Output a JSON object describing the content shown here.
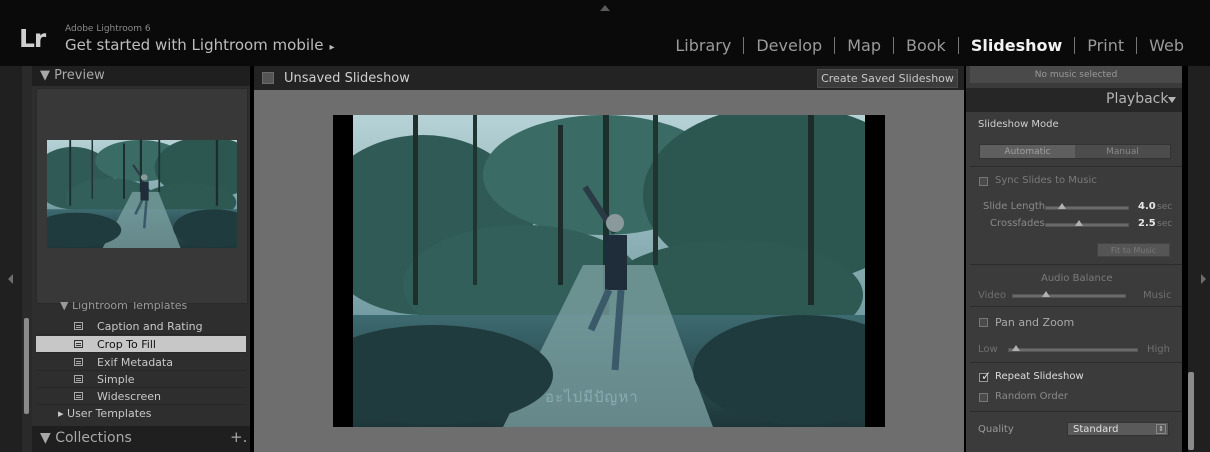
{
  "app": {
    "logo": "Lr",
    "product": "Adobe Lightroom 6",
    "mobile_prompt": "Get started with Lightroom mobile",
    "mobile_arrow": "▸"
  },
  "modules": [
    "Library",
    "Develop",
    "Map",
    "Book",
    "Slideshow",
    "Print",
    "Web"
  ],
  "active_module": "Slideshow",
  "left_panel": {
    "preview_title": "▼ Preview",
    "templates_group": "▼ Lightroom Templates",
    "templates": [
      {
        "label": "Caption and Rating"
      },
      {
        "label": "Crop To Fill"
      },
      {
        "label": "Exif Metadata"
      },
      {
        "label": "Simple"
      },
      {
        "label": "Widescreen"
      }
    ],
    "selected_template": "Crop To Fill",
    "user_templates": "▸  User Templates",
    "collections_title": "▼ Collections",
    "collections_add": "+."
  },
  "center": {
    "slideshow_title": "Unsaved Slideshow",
    "create_button": "Create Saved Slideshow",
    "slide_watermark": "อะไปมีปัญหา"
  },
  "right_panel": {
    "music": "No music selected",
    "playback_title": "Playback",
    "slideshow_mode_label": "Slideshow Mode",
    "mode_options": [
      "Automatic",
      "Manual"
    ],
    "selected_mode": "Automatic",
    "sync_label": "Sync Slides to Music",
    "sync_checked": false,
    "slide_length_label": "Slide Length",
    "slide_length_value": "4.0",
    "crossfades_label": "Crossfades",
    "crossfades_value": "2.5",
    "unit": "sec",
    "fit_button": "Fit to Music",
    "audio_balance_label": "Audio Balance",
    "audio_left": "Video",
    "audio_right": "Music",
    "pan_zoom_label": "Pan and Zoom",
    "pan_zoom_checked": false,
    "low_label": "Low",
    "high_label": "High",
    "repeat_label": "Repeat Slideshow",
    "repeat_checked": true,
    "random_label": "Random Order",
    "random_checked": false,
    "quality_label": "Quality",
    "quality_value": "Standard"
  },
  "colors": {
    "photo_tint": "#3b6f78",
    "active_module": "#f2f2f2",
    "selected_row": "#c7c7c7"
  }
}
